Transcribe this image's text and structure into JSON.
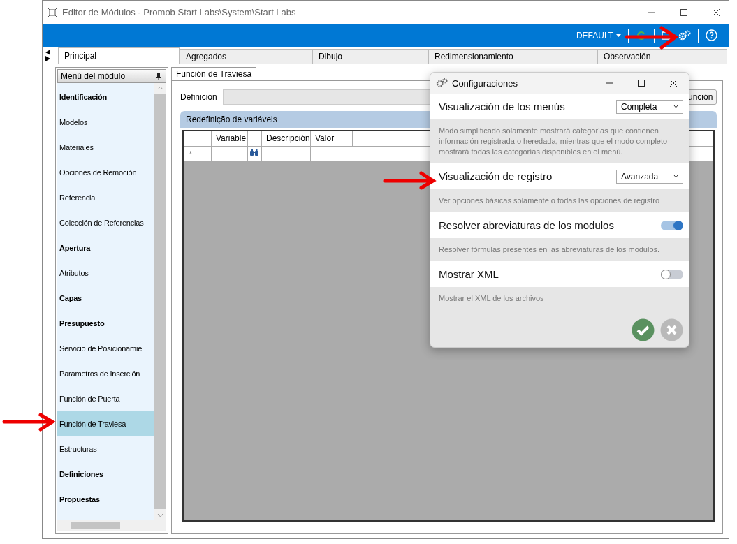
{
  "window": {
    "title": "Editor de Módulos - Promob Start Labs\\System\\Start Labs"
  },
  "toolbar": {
    "profile": "DEFAULT"
  },
  "tabs": [
    {
      "label": "Principal",
      "selected": true
    },
    {
      "label": "Agregados",
      "selected": false
    },
    {
      "label": "Dibujo",
      "selected": false
    },
    {
      "label": "Redimensionamiento",
      "selected": false
    },
    {
      "label": "Observación",
      "selected": false
    }
  ],
  "sidebar": {
    "title": "Menú del módulo",
    "items": [
      {
        "label": "Identificación",
        "kind": "category",
        "selected": false
      },
      {
        "label": "Modelos",
        "kind": "item",
        "selected": false
      },
      {
        "label": "Materiales",
        "kind": "item",
        "selected": false
      },
      {
        "label": "Opciones de Remoción",
        "kind": "item",
        "selected": false
      },
      {
        "label": "Referencia",
        "kind": "item",
        "selected": false
      },
      {
        "label": "Colección de Referencias",
        "kind": "item",
        "selected": false
      },
      {
        "label": "Apertura",
        "kind": "category",
        "selected": false
      },
      {
        "label": "Atributos",
        "kind": "item",
        "selected": false
      },
      {
        "label": "Capas",
        "kind": "category",
        "selected": false
      },
      {
        "label": "Presupuesto",
        "kind": "category",
        "selected": false
      },
      {
        "label": "Servicio de Posicionamie",
        "kind": "item",
        "selected": false
      },
      {
        "label": "Parametros de Inserción",
        "kind": "item",
        "selected": false
      },
      {
        "label": "Función de Puerta",
        "kind": "item",
        "selected": false
      },
      {
        "label": "Función de Traviesa",
        "kind": "item",
        "selected": true
      },
      {
        "label": "Estructuras",
        "kind": "item",
        "selected": false
      },
      {
        "label": "Definiciones",
        "kind": "category",
        "selected": false
      },
      {
        "label": "Propuestas",
        "kind": "category",
        "selected": false
      }
    ]
  },
  "content": {
    "tab": "Función de Traviesa",
    "definition_label": "Definición",
    "function_button": "unción",
    "group_title": "Redefinição de variáveis",
    "table": {
      "columns": [
        "Variable",
        "",
        "Descripción",
        "Valor"
      ],
      "new_row_marker": "*"
    }
  },
  "dialog": {
    "title": "Configuraciones",
    "settings": [
      {
        "kind": "select",
        "label": "Visualización de los menús",
        "value": "Completa",
        "description": "Modo simplificado solamente mostrará categorías que contienen información registrada o heredada, mientras que el modo completo mostrará todas las categorías disponibles en el menú."
      },
      {
        "kind": "select",
        "label": "Visualización de registro",
        "value": "Avanzada",
        "description": "Ver opciones básicas solamente o todas las opciones de registro"
      },
      {
        "kind": "toggle",
        "label": "Resolver abreviaturas de los modulos",
        "on": true,
        "description": "Resolver fórmulas presentes en las abreviaturas de los modulos."
      },
      {
        "kind": "toggle",
        "label": "Mostrar XML",
        "on": false,
        "description": "Mostrar el XML de los archivos"
      }
    ]
  }
}
